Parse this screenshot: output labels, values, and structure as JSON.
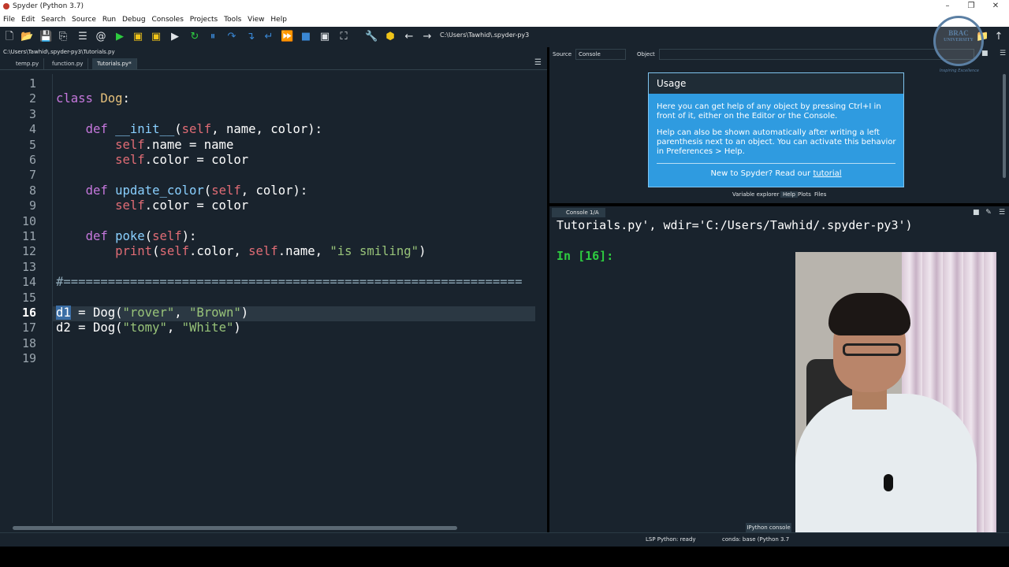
{
  "window": {
    "title": "Spyder (Python 3.7)",
    "minimize": "–",
    "maximize": "❐",
    "close": "✕"
  },
  "menu": [
    "File",
    "Edit",
    "Search",
    "Source",
    "Run",
    "Debug",
    "Consoles",
    "Projects",
    "Tools",
    "View",
    "Help"
  ],
  "toolbar": {
    "working_directory": "C:\\Users\\Tawhid\\.spyder-py3"
  },
  "editor": {
    "file_path": "C:\\Users\\Tawhid\\.spyder-py3\\Tutorials.py",
    "tabs": [
      "temp.py",
      "function.py",
      "Tutorials.py*"
    ],
    "active_tab": "Tutorials.py*",
    "current_line": 16,
    "lines": [
      "",
      "class Dog:",
      "",
      "    def __init__(self, name, color):",
      "        self.name = name",
      "        self.color = color",
      "",
      "    def update_color(self, color):",
      "        self.color = color",
      "",
      "    def poke(self):",
      "        print(self.color, self.name, \"is smiling\")",
      "",
      "#==============================================================",
      "",
      "d1 = Dog(\"rover\", \"Brown\")",
      "d2 = Dog(\"tomy\", \"White\")",
      "",
      ""
    ]
  },
  "help": {
    "source_label": "Source",
    "source_value": "Console",
    "object_label": "Object",
    "usage_title": "Usage",
    "usage_p1": "Here you can get help of any object by pressing Ctrl+I in front of it, either on the Editor or the Console.",
    "usage_p2": "Help can also be shown automatically after writing a left parenthesis next to an object. You can activate this behavior in Preferences > Help.",
    "usage_footer_text": "New to Spyder? Read our ",
    "usage_footer_link": "tutorial",
    "pane_tabs": [
      "Variable explorer",
      "Help",
      "Plots",
      "Files"
    ],
    "active_pane_tab": "Help"
  },
  "console": {
    "tab_label": "Console 1/A",
    "output_line": "Tutorials.py', wdir='C:/Users/Tawhid/.spyder-py3')",
    "prompt": "In [16]:",
    "bottom_tab": "IPython console"
  },
  "logo": {
    "line1": "BRAC",
    "line2": "UNIVERSITY",
    "tagline": "Inspiring Excellence"
  },
  "statusbar": {
    "lsp": "LSP Python: ready",
    "conda": "conda: base (Python 3.7"
  },
  "colors": {
    "background": "#19232d",
    "usage_box": "#2f9be0",
    "prompt": "#2ecc40"
  }
}
